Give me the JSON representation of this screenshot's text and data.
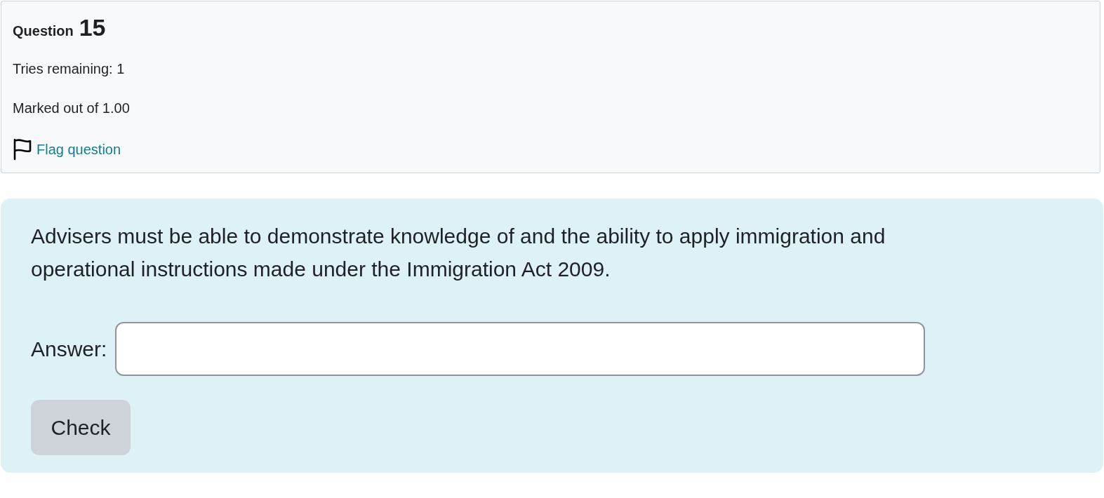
{
  "info": {
    "heading_label": "Question",
    "number": "15",
    "tries": "Tries remaining: 1",
    "grade": "Marked out of 1.00",
    "flag": {
      "label": "Flag question",
      "flagged": false
    }
  },
  "question": {
    "text": "Advisers must be able to demonstrate knowledge of and the ability to apply immigration and operational instructions made under the Immigration Act 2009.",
    "answer_label": "Answer:",
    "check_button": "Check"
  }
}
